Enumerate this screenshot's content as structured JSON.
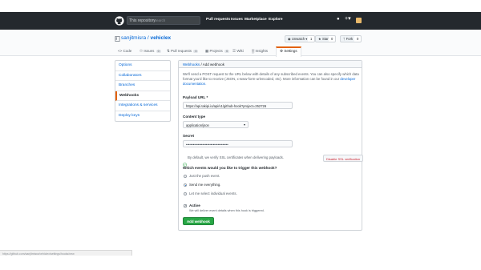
{
  "topbar": {
    "scope_label": "This repository",
    "search_placeholder": "Search",
    "nav": [
      "Pull requests",
      "Issues",
      "Marketplace",
      "Explore"
    ],
    "icons": [
      "bell-icon",
      "plus-icon",
      "avatar"
    ]
  },
  "repo": {
    "owner": "sanjitmisra",
    "separator": " / ",
    "name": "vehiclex",
    "unwatch_label": "Unwatch",
    "unwatch_count": "1",
    "star_label": "Star",
    "star_count": "0",
    "fork_label": "Fork",
    "fork_count": "0"
  },
  "tabs": [
    {
      "label": "Code",
      "count": ""
    },
    {
      "label": "Issues",
      "count": "0"
    },
    {
      "label": "Pull requests",
      "count": "0"
    },
    {
      "label": "Projects",
      "count": "0"
    },
    {
      "label": "Wiki",
      "count": ""
    },
    {
      "label": "Insights",
      "count": ""
    },
    {
      "label": "Settings",
      "count": ""
    }
  ],
  "sidebar": {
    "items": [
      "Options",
      "Collaborators",
      "Branches",
      "Webhooks",
      "Integrations & services",
      "Deploy keys"
    ],
    "selected": 3
  },
  "form": {
    "breadcrumb_link": "Webhooks",
    "breadcrumb_sep": " / ",
    "breadcrumb_current": "Add webhook",
    "intro_1": "We'll send a POST request to the URL below with details of any subscribed events. You can also specify which data",
    "intro_2": "format you'd like to receive (JSON, x-www-form-urlencoded, etc). More information can be found in our",
    "intro_link": "developer",
    "intro_3": "documentation.",
    "payload_label": "Payload URL *",
    "payload_value": "https://api.takipi.io/api/v1/github-hook?project=252726",
    "content_type_label": "Content type",
    "content_type_value": "application/json",
    "secret_label": "Secret",
    "secret_value": "••••••••••••••••••••••••••••••••••••",
    "ssl_note": "By default, we verify SSL certificates when delivering payloads.",
    "ssl_button": "Disable SSL verification",
    "events_question": "Which events would you like to trigger this webhook?",
    "event_options": [
      "Just the push event.",
      "Send me everything.",
      "Let me select individual events."
    ],
    "event_selected": 1,
    "active_label": "Active",
    "active_note": "We will deliver event details when this hook is triggered.",
    "submit_label": "Add webhook"
  },
  "status_url": "https://github.com/sanjitmisra/vehiclex/settings/hooks/new"
}
